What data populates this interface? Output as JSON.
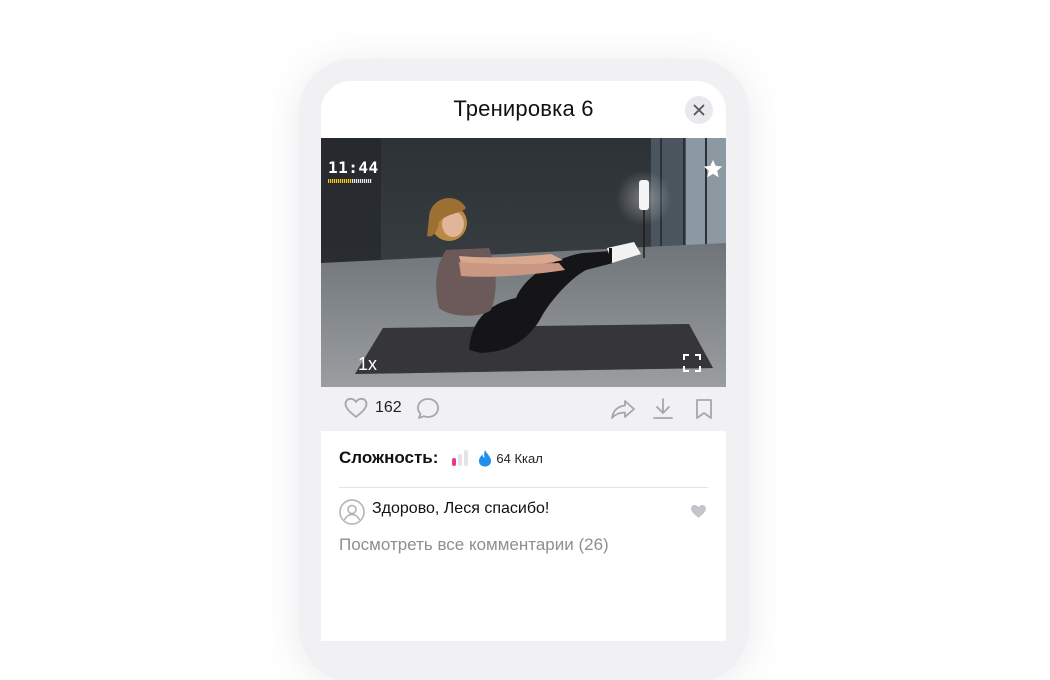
{
  "header": {
    "title": "Тренировка 6",
    "close_icon": "close-icon"
  },
  "video": {
    "timer": "11:44",
    "timer_progress": 0.55,
    "speed_label": "1x",
    "favorite_icon": "star-icon",
    "fullscreen_icon": "fullscreen-icon"
  },
  "actions": {
    "like_icon": "heart-outline-icon",
    "likes_count": "162",
    "comment_icon": "comment-bubble-icon",
    "share_icon": "share-icon",
    "download_icon": "download-icon",
    "bookmark_icon": "bookmark-icon"
  },
  "meta": {
    "difficulty_label": "Сложность:",
    "difficulty_level": 1,
    "difficulty_max": 3,
    "calories": "64 Ккал",
    "flame_color": "#1e8ef0",
    "difficulty_color": "#e6398f"
  },
  "comments": {
    "latest": {
      "text": "Здорово, Леся спасибо!",
      "avatar_icon": "user-avatar-icon",
      "like_icon": "heart-filled-icon"
    },
    "view_all": "Посмотреть все комментарии (26)"
  }
}
